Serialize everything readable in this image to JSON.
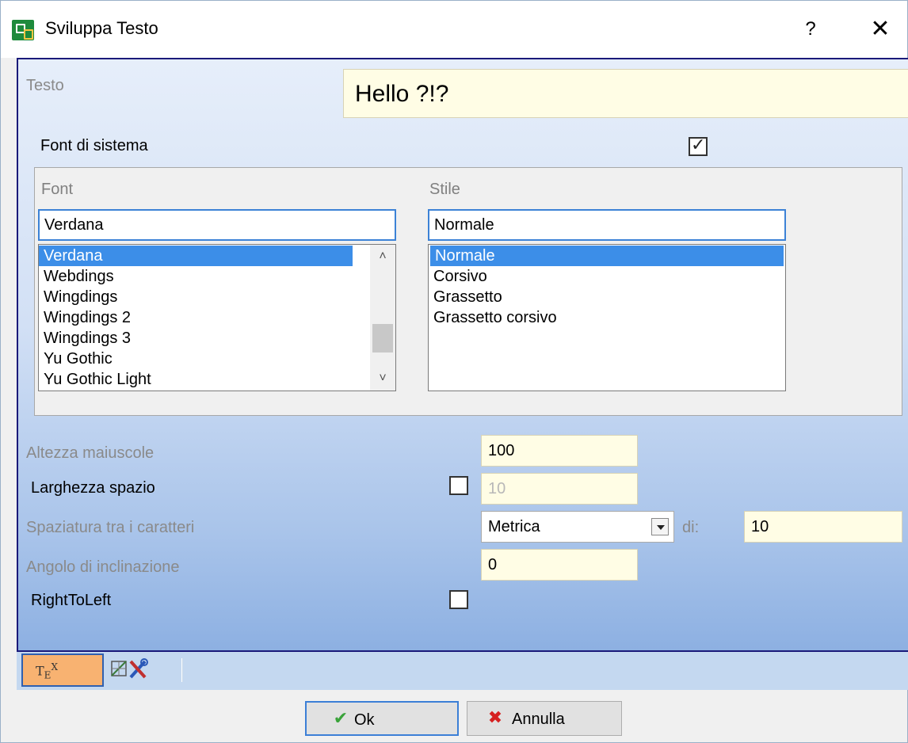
{
  "window": {
    "title": "Sviluppa Testo",
    "help": "?",
    "close": "✕"
  },
  "text": {
    "label": "Testo",
    "value": "Hello ?!?"
  },
  "system_font": {
    "label": "Font di sistema",
    "checked": true
  },
  "font": {
    "label": "Font",
    "value": "Verdana",
    "items": [
      "Verdana",
      "Webdings",
      "Wingdings",
      "Wingdings 2",
      "Wingdings 3",
      "Yu Gothic",
      "Yu Gothic Light"
    ],
    "selected": "Verdana"
  },
  "style": {
    "label": "Stile",
    "value": "Normale",
    "items": [
      "Normale",
      "Corsivo",
      "Grassetto",
      "Grassetto corsivo"
    ],
    "selected": "Normale"
  },
  "cap_height": {
    "label": "Altezza maiuscole",
    "value": "100"
  },
  "space_width": {
    "label": "Larghezza spazio",
    "checked": false,
    "value": "10"
  },
  "char_spacing": {
    "label": "Spaziatura tra i caratteri",
    "mode": "Metrica",
    "of_label": "di:",
    "value": "10"
  },
  "slant": {
    "label": "Angolo di inclinazione",
    "value": "0"
  },
  "rtl": {
    "label": "RightToLeft",
    "checked": false
  },
  "tabs": {
    "text_tab": "TEX",
    "tools_icon": "tools-icon"
  },
  "buttons": {
    "ok": "Ok",
    "cancel": "Annulla"
  }
}
